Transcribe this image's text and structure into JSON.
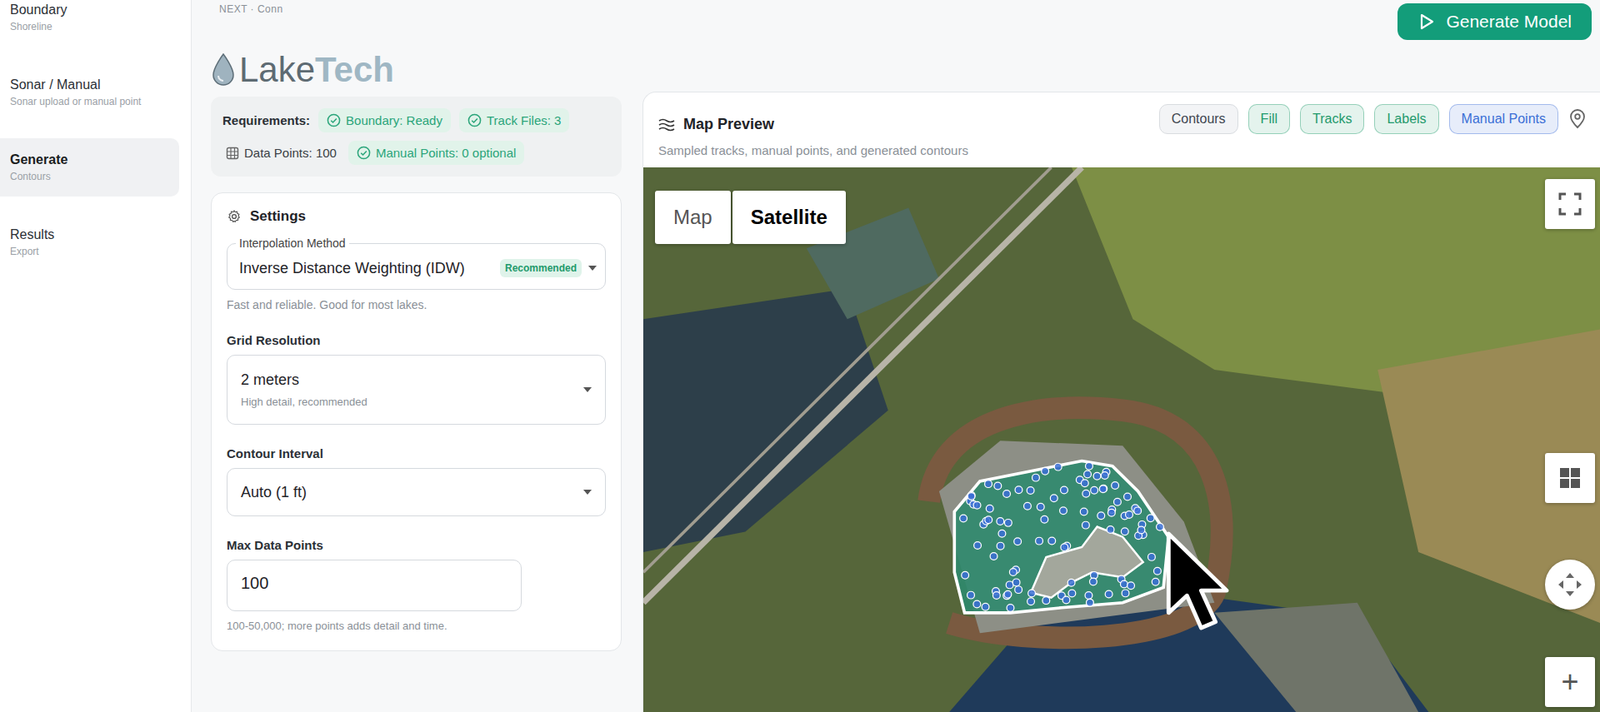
{
  "header": {
    "next_hint": "NEXT · Conn",
    "generate_button": "Generate Model"
  },
  "logo": {
    "first": "Lake",
    "second": "Tech"
  },
  "sidebar": {
    "items": [
      {
        "title": "Boundary",
        "subtitle": "Shoreline",
        "selected": false
      },
      {
        "title": "Sonar / Manual",
        "subtitle": "Sonar upload or manual point",
        "selected": false
      },
      {
        "title": "Generate",
        "subtitle": "Contours",
        "selected": true
      },
      {
        "title": "Results",
        "subtitle": "Export",
        "selected": false
      }
    ]
  },
  "requirements": {
    "label": "Requirements:",
    "items": [
      {
        "label": "Boundary: Ready",
        "kind": "chip"
      },
      {
        "label": "Track Files: 3",
        "kind": "chip"
      },
      {
        "label": "Data Points: 100",
        "kind": "plain"
      },
      {
        "label": "Manual Points: 0 optional",
        "kind": "chip"
      }
    ]
  },
  "settings": {
    "title": "Settings",
    "interpolation": {
      "label": "Interpolation Method",
      "value": "Inverse Distance Weighting (IDW)",
      "badge": "Recommended",
      "help": "Fast and reliable. Good for most lakes."
    },
    "grid_resolution": {
      "label": "Grid Resolution",
      "value": "2 meters",
      "detail": "High detail, recommended"
    },
    "contour_interval": {
      "label": "Contour Interval",
      "value": "Auto (1 ft)"
    },
    "max_points": {
      "label": "Max Data Points",
      "value": "100",
      "help": "100-50,000; more points adds detail and time."
    }
  },
  "map_preview": {
    "title": "Map Preview",
    "subtitle": "Sampled tracks, manual points, and generated contours",
    "layers": [
      {
        "label": "Contours",
        "on": false,
        "color": "#6b7280"
      },
      {
        "label": "Fill",
        "on": true,
        "color": "#1f9a6c"
      },
      {
        "label": "Tracks",
        "on": true,
        "color": "#1f9a6c"
      },
      {
        "label": "Labels",
        "on": true,
        "color": "#1f9a6c"
      },
      {
        "label": "Manual Points",
        "on": true,
        "color": "#3b6fd6"
      }
    ],
    "map_types": [
      {
        "label": "Map",
        "selected": false
      },
      {
        "label": "Satellite",
        "selected": true
      }
    ],
    "zoom_in": "+"
  }
}
